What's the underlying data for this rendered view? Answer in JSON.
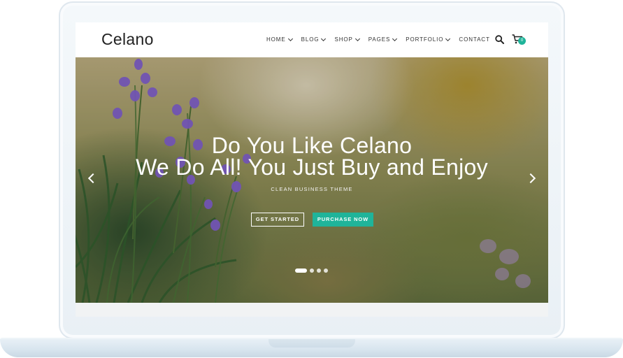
{
  "site": {
    "logo": "Celano"
  },
  "nav": {
    "items": [
      {
        "label": "HOME",
        "dropdown": true
      },
      {
        "label": "BLOG",
        "dropdown": true
      },
      {
        "label": "SHOP",
        "dropdown": true
      },
      {
        "label": "PAGES",
        "dropdown": true
      },
      {
        "label": "PORTFOLIO",
        "dropdown": true
      },
      {
        "label": "CONTACT",
        "dropdown": false
      }
    ],
    "cart_count": "0"
  },
  "hero": {
    "title_line1": "Do You Like Celano",
    "title_line2": "We Do All! You Just Buy and Enjoy",
    "subtitle": "CLEAN BUSINESS THEME",
    "primary_button": "GET STARTED",
    "secondary_button": "PURCHASE NOW",
    "slide_count": 4,
    "active_slide": 1
  },
  "colors": {
    "accent": "#1fb49a",
    "text_dark": "#222222"
  }
}
